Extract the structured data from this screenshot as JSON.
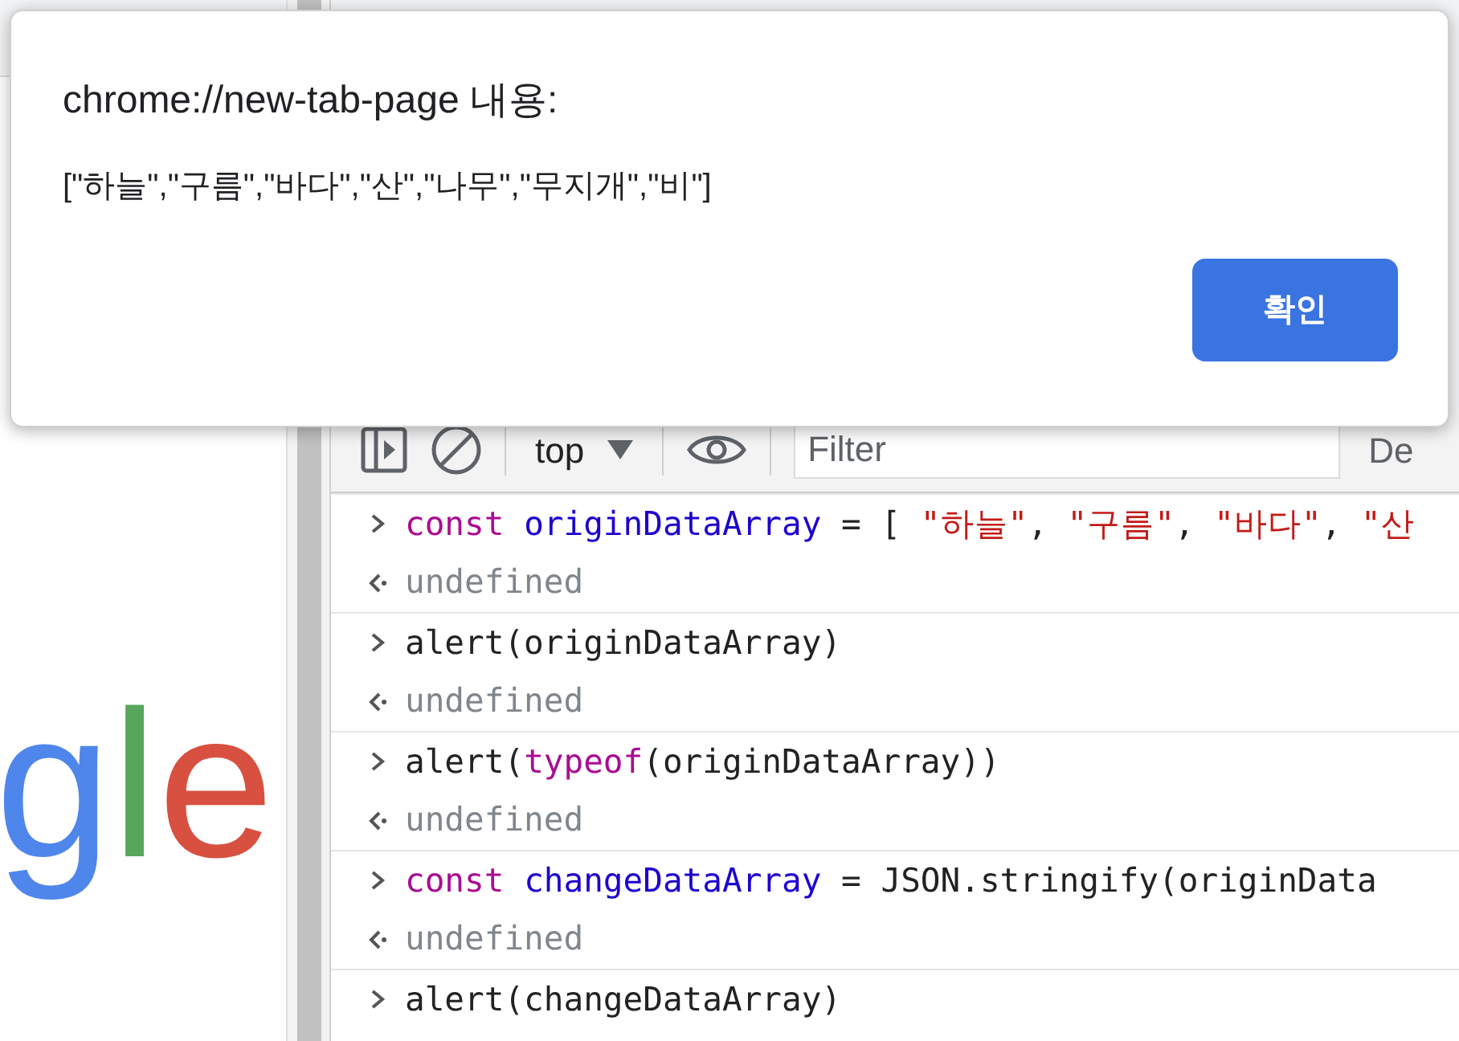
{
  "dialog": {
    "title": "chrome://new-tab-page 내용:",
    "message": "[\"하늘\",\"구름\",\"바다\",\"산\",\"나무\",\"무지개\",\"비\"]",
    "button": "확인"
  },
  "logo": [
    {
      "char": "g",
      "color": "#4f86ec"
    },
    {
      "char": "l",
      "color": "#58a65c"
    },
    {
      "char": "e",
      "color": "#d85040"
    }
  ],
  "toolbar": {
    "context": "top",
    "filter": {
      "placeholder": "Filter"
    },
    "levels": "De"
  },
  "console": [
    {
      "kind": "input",
      "tokens": [
        {
          "kind": "keyword",
          "text": "const "
        },
        {
          "kind": "variable",
          "text": "originDataArray"
        },
        {
          "kind": "plain",
          "text": " = [ "
        },
        {
          "kind": "string",
          "text": "\"하늘\""
        },
        {
          "kind": "plain",
          "text": ", "
        },
        {
          "kind": "string",
          "text": "\"구름\""
        },
        {
          "kind": "plain",
          "text": ", "
        },
        {
          "kind": "string",
          "text": "\"바다\""
        },
        {
          "kind": "plain",
          "text": ", "
        },
        {
          "kind": "string",
          "text": "\"산"
        }
      ]
    },
    {
      "kind": "output",
      "text": "undefined"
    },
    {
      "kind": "input",
      "tokens": [
        {
          "kind": "plain",
          "text": "alert(originDataArray)"
        }
      ]
    },
    {
      "kind": "output",
      "text": "undefined"
    },
    {
      "kind": "input",
      "tokens": [
        {
          "kind": "plain",
          "text": "alert("
        },
        {
          "kind": "keyword",
          "text": "typeof"
        },
        {
          "kind": "plain",
          "text": "(originDataArray))"
        }
      ]
    },
    {
      "kind": "output",
      "text": "undefined"
    },
    {
      "kind": "input",
      "tokens": [
        {
          "kind": "keyword",
          "text": "const "
        },
        {
          "kind": "variable",
          "text": "changeDataArray"
        },
        {
          "kind": "plain",
          "text": " = JSON.stringify(originData"
        }
      ]
    },
    {
      "kind": "output",
      "text": "undefined"
    },
    {
      "kind": "input",
      "tokens": [
        {
          "kind": "plain",
          "text": "alert(changeDataArray)"
        }
      ]
    }
  ]
}
